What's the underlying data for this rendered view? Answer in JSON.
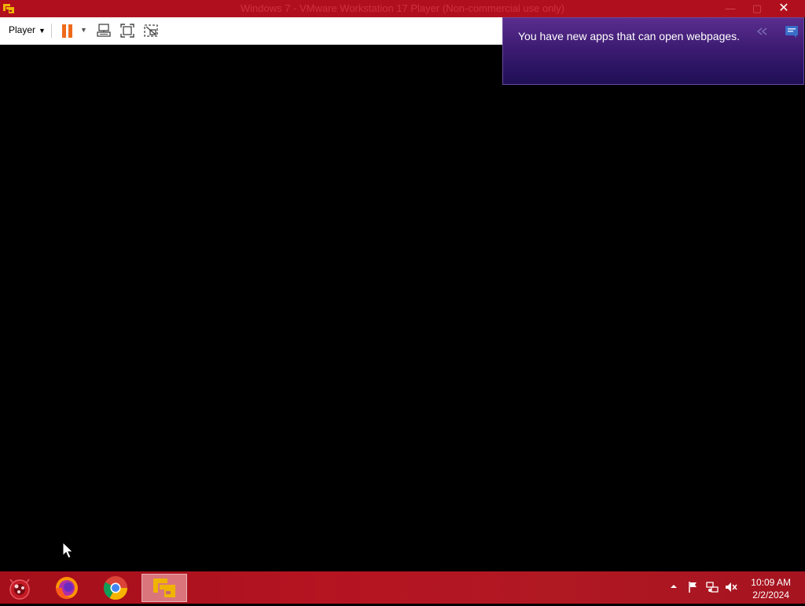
{
  "window": {
    "title": "Windows 7 - VMware Workstation 17 Player (Non-commercial use only)",
    "close_glyph": "✕"
  },
  "toolbar": {
    "player_label": "Player"
  },
  "notification": {
    "message": "You have new apps that can open webpages."
  },
  "taskbar": {
    "apps": [
      "start-orb",
      "firefox",
      "chrome",
      "vmware-player"
    ],
    "active_app": "vmware-player",
    "clock": {
      "time": "10:09 AM",
      "date": "2/2/2024"
    }
  },
  "colors": {
    "titlebar": "#b0101e",
    "notification_bg": "#3a1a70",
    "pause_orange": "#ee6a1a",
    "vm_screen": "#000000"
  }
}
